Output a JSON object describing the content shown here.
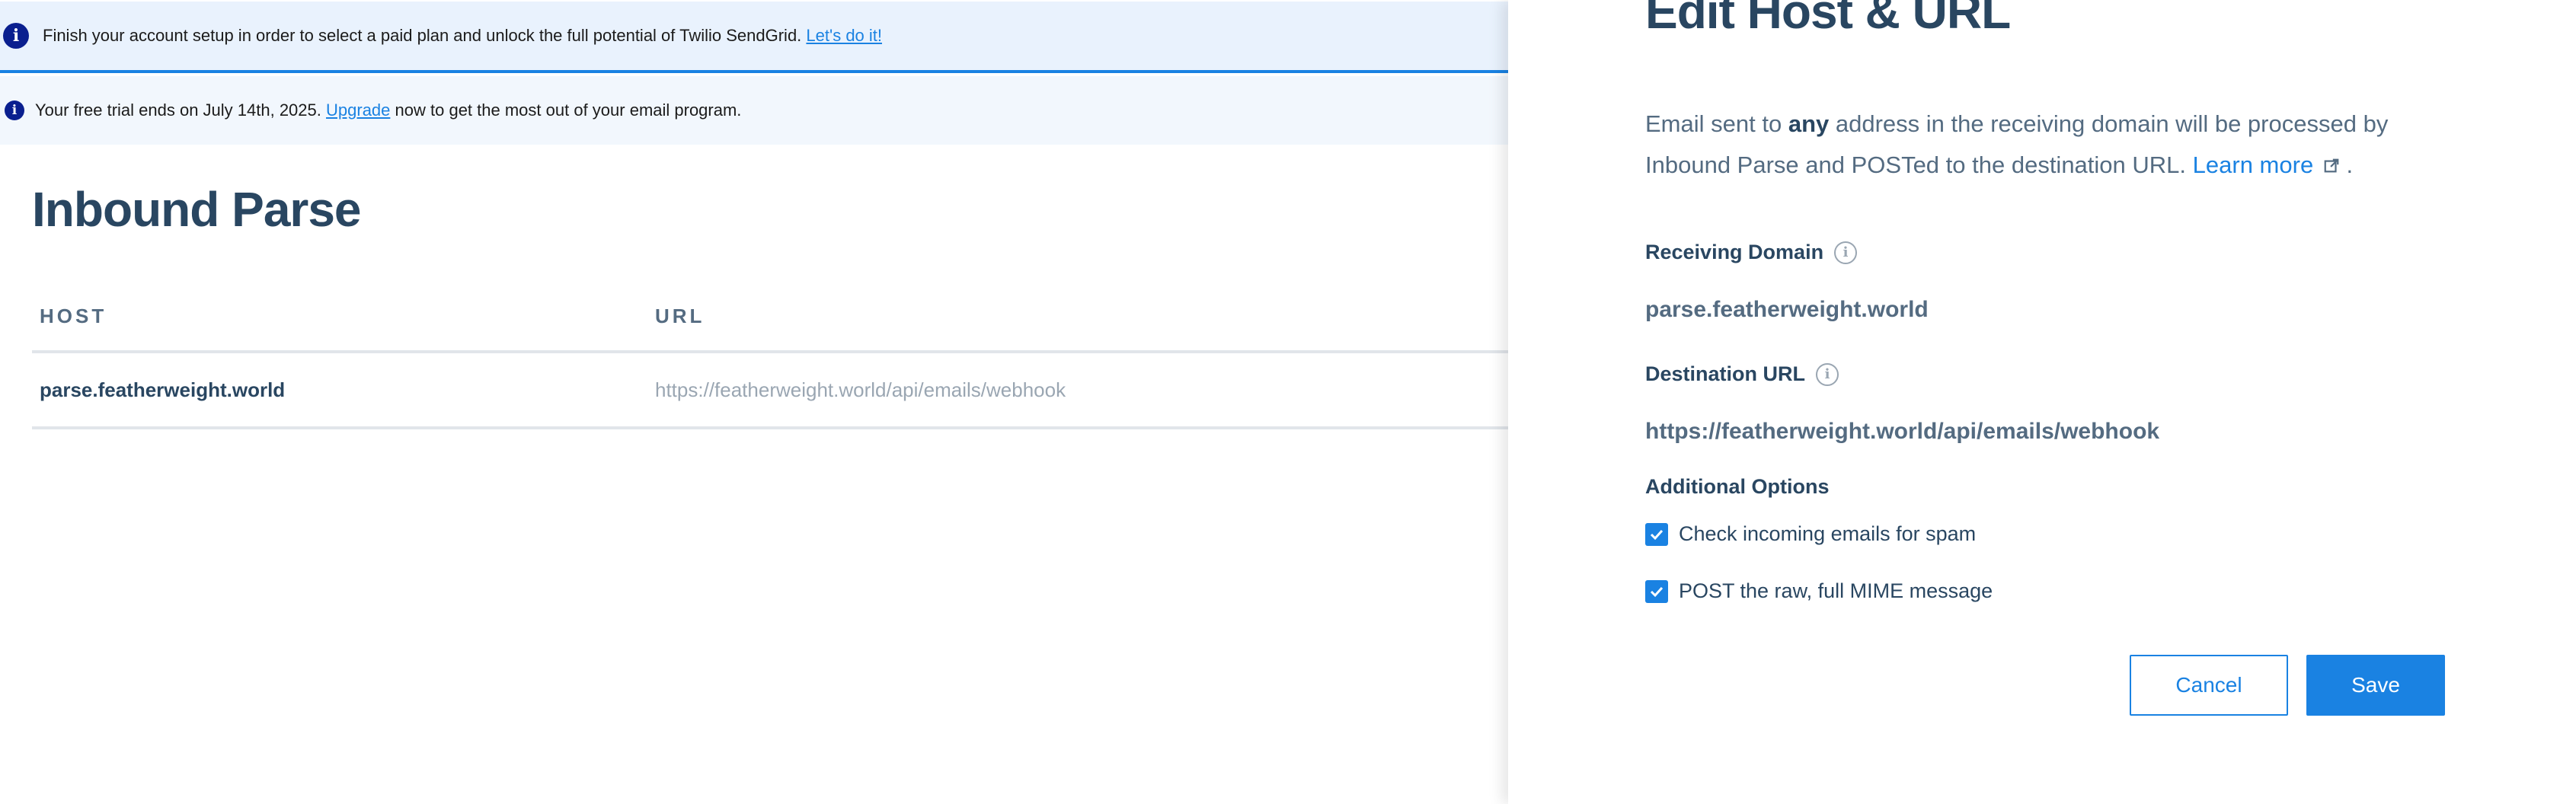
{
  "banners": {
    "setup": {
      "text": "Finish your account setup in order to select a paid plan and unlock the full potential of Twilio SendGrid.",
      "link": "Let's do it!"
    },
    "trial": {
      "text_before": "Your free trial ends on July 14th, 2025.",
      "link": "Upgrade",
      "text_after": "now to get the most out of your email program."
    }
  },
  "page": {
    "title": "Inbound Parse",
    "table": {
      "headers": {
        "host": "HOST",
        "url": "URL"
      },
      "rows": [
        {
          "host": "parse.featherweight.world",
          "url": "https://featherweight.world/api/emails/webhook"
        }
      ]
    }
  },
  "panel": {
    "title": "Edit Host & URL",
    "description": {
      "part1": "Email sent to",
      "bold": "any",
      "part2": "address in the receiving domain will be processed by Inbound Parse and POSTed to the destination URL.",
      "link": "Learn more",
      "end": "."
    },
    "receiving_domain": {
      "label": "Receiving Domain",
      "value": "parse.featherweight.world"
    },
    "destination_url": {
      "label": "Destination URL",
      "value": "https://featherweight.world/api/emails/webhook"
    },
    "options": {
      "label": "Additional Options",
      "spam_check": {
        "label": "Check incoming emails for spam",
        "checked": true
      },
      "raw_mime": {
        "label": "POST the raw, full MIME message",
        "checked": true
      }
    },
    "buttons": {
      "cancel": "Cancel",
      "save": "Save"
    }
  },
  "colors": {
    "accent": "#1a82e2",
    "heading": "#294661",
    "muted": "#546b81",
    "info_icon": "#0a1f8f",
    "banner_bg": "#e9f2fd"
  },
  "icons": {
    "info": "info-circle-icon",
    "tooltip": "info-outline-icon",
    "external": "external-link-icon",
    "check": "checkmark-icon"
  }
}
